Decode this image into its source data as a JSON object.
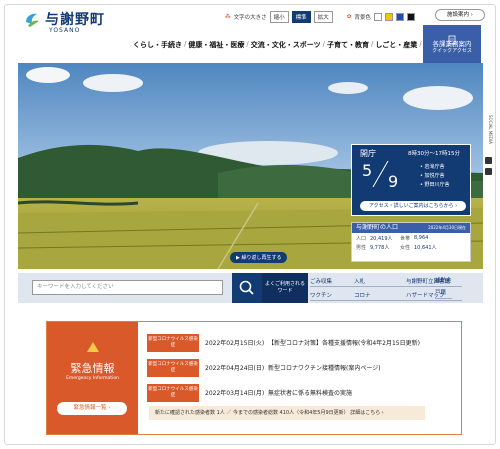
{
  "header": {
    "logo_text": "与謝野町",
    "logo_sub": "YOSANO",
    "font_size_label": "文字の大きさ",
    "font_sizes": [
      "縮小",
      "標準",
      "拡大"
    ],
    "bg_color_label": "背景色",
    "swatch_colors": [
      "#ffffff",
      "#f5c400",
      "#1b4fb3",
      "#111111"
    ],
    "hub_label": "施設案内"
  },
  "gnav": {
    "items": [
      "くらし・手続き",
      "健康・福祉・医療",
      "交流・文化・スポーツ",
      "子育て・教育",
      "しごと・産業",
      "町政"
    ]
  },
  "quick": {
    "title": "各課業務案内",
    "subtitle": "クイックアクセス",
    "link": "取扱い業務で探す"
  },
  "social": {
    "label": "SOCIAL MEDIA"
  },
  "office": {
    "label": "開庁",
    "hours": "8時30分～17時15分",
    "month": "5",
    "day": "9",
    "offices": [
      "岩滝庁舎",
      "加悦庁舎",
      "野田川庁舎"
    ],
    "access": "アクセス・詳しいご案内はこちらから"
  },
  "population": {
    "title": "与謝野町の人口",
    "date": "2022年4月30日現在",
    "rows": [
      {
        "k1": "人口",
        "v1": "20,419人",
        "k2": "世帯",
        "v2": "8,964"
      },
      {
        "k1": "男性",
        "v1": "9,778人",
        "k2": "女性",
        "v2": "10,641人"
      }
    ]
  },
  "hero": {
    "slide_button": "繰り返し再生する"
  },
  "search": {
    "placeholder": "キーワードを入力してください",
    "faq": "よくご利用される",
    "faq2": "ワード",
    "words": [
      "ごみ収集",
      "入札",
      "与謝野町立図書館",
      "ワクチン",
      "コロナ",
      "ハザードマップ"
    ],
    "extra": [
      "補助金",
      "戸籍"
    ]
  },
  "emergency": {
    "title": "緊急情報",
    "subtitle": "Emergency Information",
    "list_button": "緊急情報一覧",
    "items": [
      {
        "tag": "新型コロナウイルス感染症",
        "date": "2022年02月15日(火)",
        "title": "【新型コロナ対策】各種支援情報(令和4年2月15日更新)"
      },
      {
        "tag": "新型コロナウイルス感染症",
        "date": "2022年04月24日(日)",
        "title": "新型コロナワクチン接種情報(案内ページ)"
      },
      {
        "tag": "新型コロナウイルス感染症",
        "date": "2022年03月14日(月)",
        "title": "無症状者に係る無料検査の実施"
      }
    ],
    "note": "新たに確認された感染者数 1人 ／ 今までの感染者総数 410人（令和4年5月9日更新） 詳細はこちら ›"
  }
}
